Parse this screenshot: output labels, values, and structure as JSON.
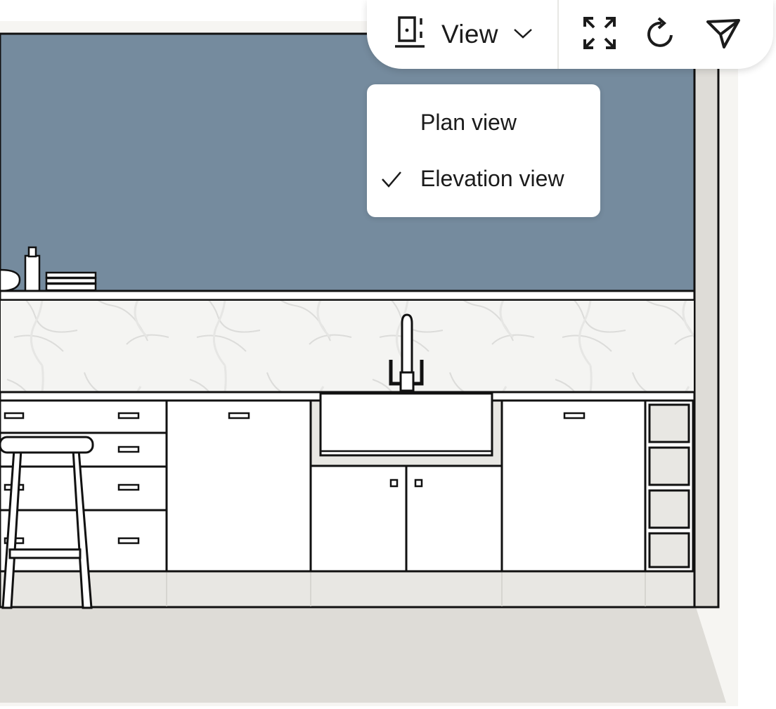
{
  "toolbar": {
    "view_label": "View",
    "icons": [
      "view-mode-icon",
      "chevron-down-icon",
      "fullscreen-icon",
      "rotate-icon",
      "share-icon"
    ]
  },
  "view_menu": {
    "items": [
      {
        "label": "Plan view",
        "selected": false
      },
      {
        "label": "Elevation view",
        "selected": true
      }
    ]
  },
  "colors": {
    "wall": "#758b9e",
    "floor": "#dedcd7",
    "background": "#f6f5f2",
    "outline": "#111111"
  }
}
